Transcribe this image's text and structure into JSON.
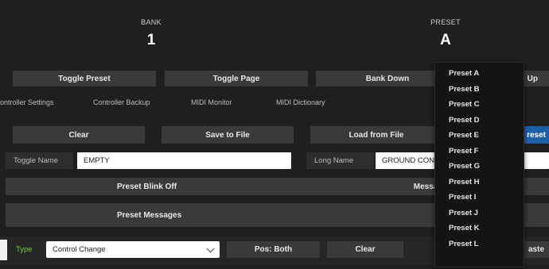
{
  "header": {
    "bank_label": "BANK",
    "bank_value": "1",
    "preset_label": "PRESET",
    "preset_value": "A"
  },
  "toolbar": {
    "toggle_preset": "Toggle Preset",
    "toggle_page": "Toggle Page",
    "bank_down": "Bank Down",
    "bank_up_partial": "Up"
  },
  "nav": {
    "controller_settings": "ontroller Settings",
    "controller_backup": "Controller Backup",
    "midi_monitor": "MIDI Monitor",
    "midi_dictionary": "MIDI Dictionary"
  },
  "actions": {
    "clear": "Clear",
    "save_to_file": "Save to File",
    "load_from_file": "Load from File",
    "preset_partial": "reset"
  },
  "names": {
    "toggle_name_label": "Toggle Name",
    "toggle_name_value": "EMPTY",
    "long_name_label": "Long Name",
    "long_name_value": "GROUND CON"
  },
  "rows": {
    "preset_blink": "Preset Blink Off",
    "message_partial": "Message",
    "preset_messages": "Preset Messages"
  },
  "message_editor": {
    "type_label": "Type",
    "type_value": "Control Change",
    "pos": "Pos: Both",
    "clear": "Clear",
    "paste_partial": "aste"
  },
  "dropdown": {
    "items": [
      "Preset A",
      "Preset B",
      "Preset C",
      "Preset D",
      "Preset E",
      "Preset F",
      "Preset G",
      "Preset H",
      "Preset I",
      "Preset J",
      "Preset K",
      "Preset L"
    ]
  }
}
